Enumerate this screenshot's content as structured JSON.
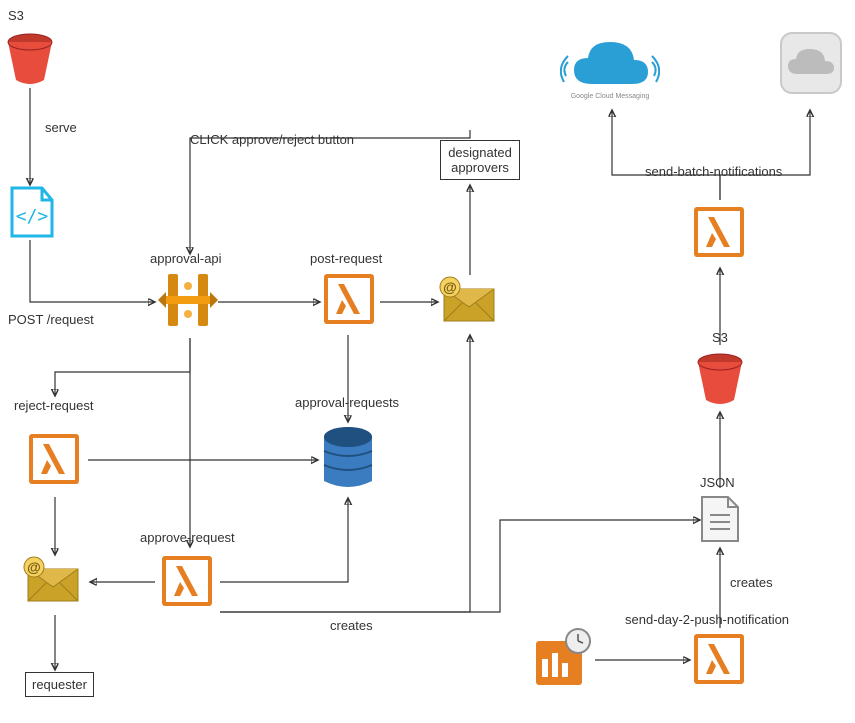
{
  "nodes": {
    "s3_top": {
      "label": "S3"
    },
    "code_icon": {
      "label": ""
    },
    "approval_api": {
      "label": "approval-api"
    },
    "post_request": {
      "label": "post-request"
    },
    "designated_approvers": {
      "label": "designated\napprovers"
    },
    "reject_request": {
      "label": "reject-request"
    },
    "approve_request": {
      "label": "approve-request"
    },
    "approval_requests": {
      "label": "approval-requests"
    },
    "requester": {
      "label": "requester"
    },
    "mail_left": {
      "label": ""
    },
    "mail_right": {
      "label": ""
    },
    "scheduled": {
      "label": ""
    },
    "send_day2": {
      "label": "send-day-2-push-notification"
    },
    "json_doc": {
      "label": "JSON"
    },
    "s3_right": {
      "label": "S3"
    },
    "send_batch": {
      "label": "send-batch-notifications"
    },
    "google_cloud": {
      "label": ""
    },
    "apple_cloud": {
      "label": ""
    }
  },
  "edges": {
    "serve": "serve",
    "post_request_text": "POST /request",
    "click_approve": "CLICK approve/reject button",
    "creates_left": "creates",
    "creates_right": "creates"
  }
}
